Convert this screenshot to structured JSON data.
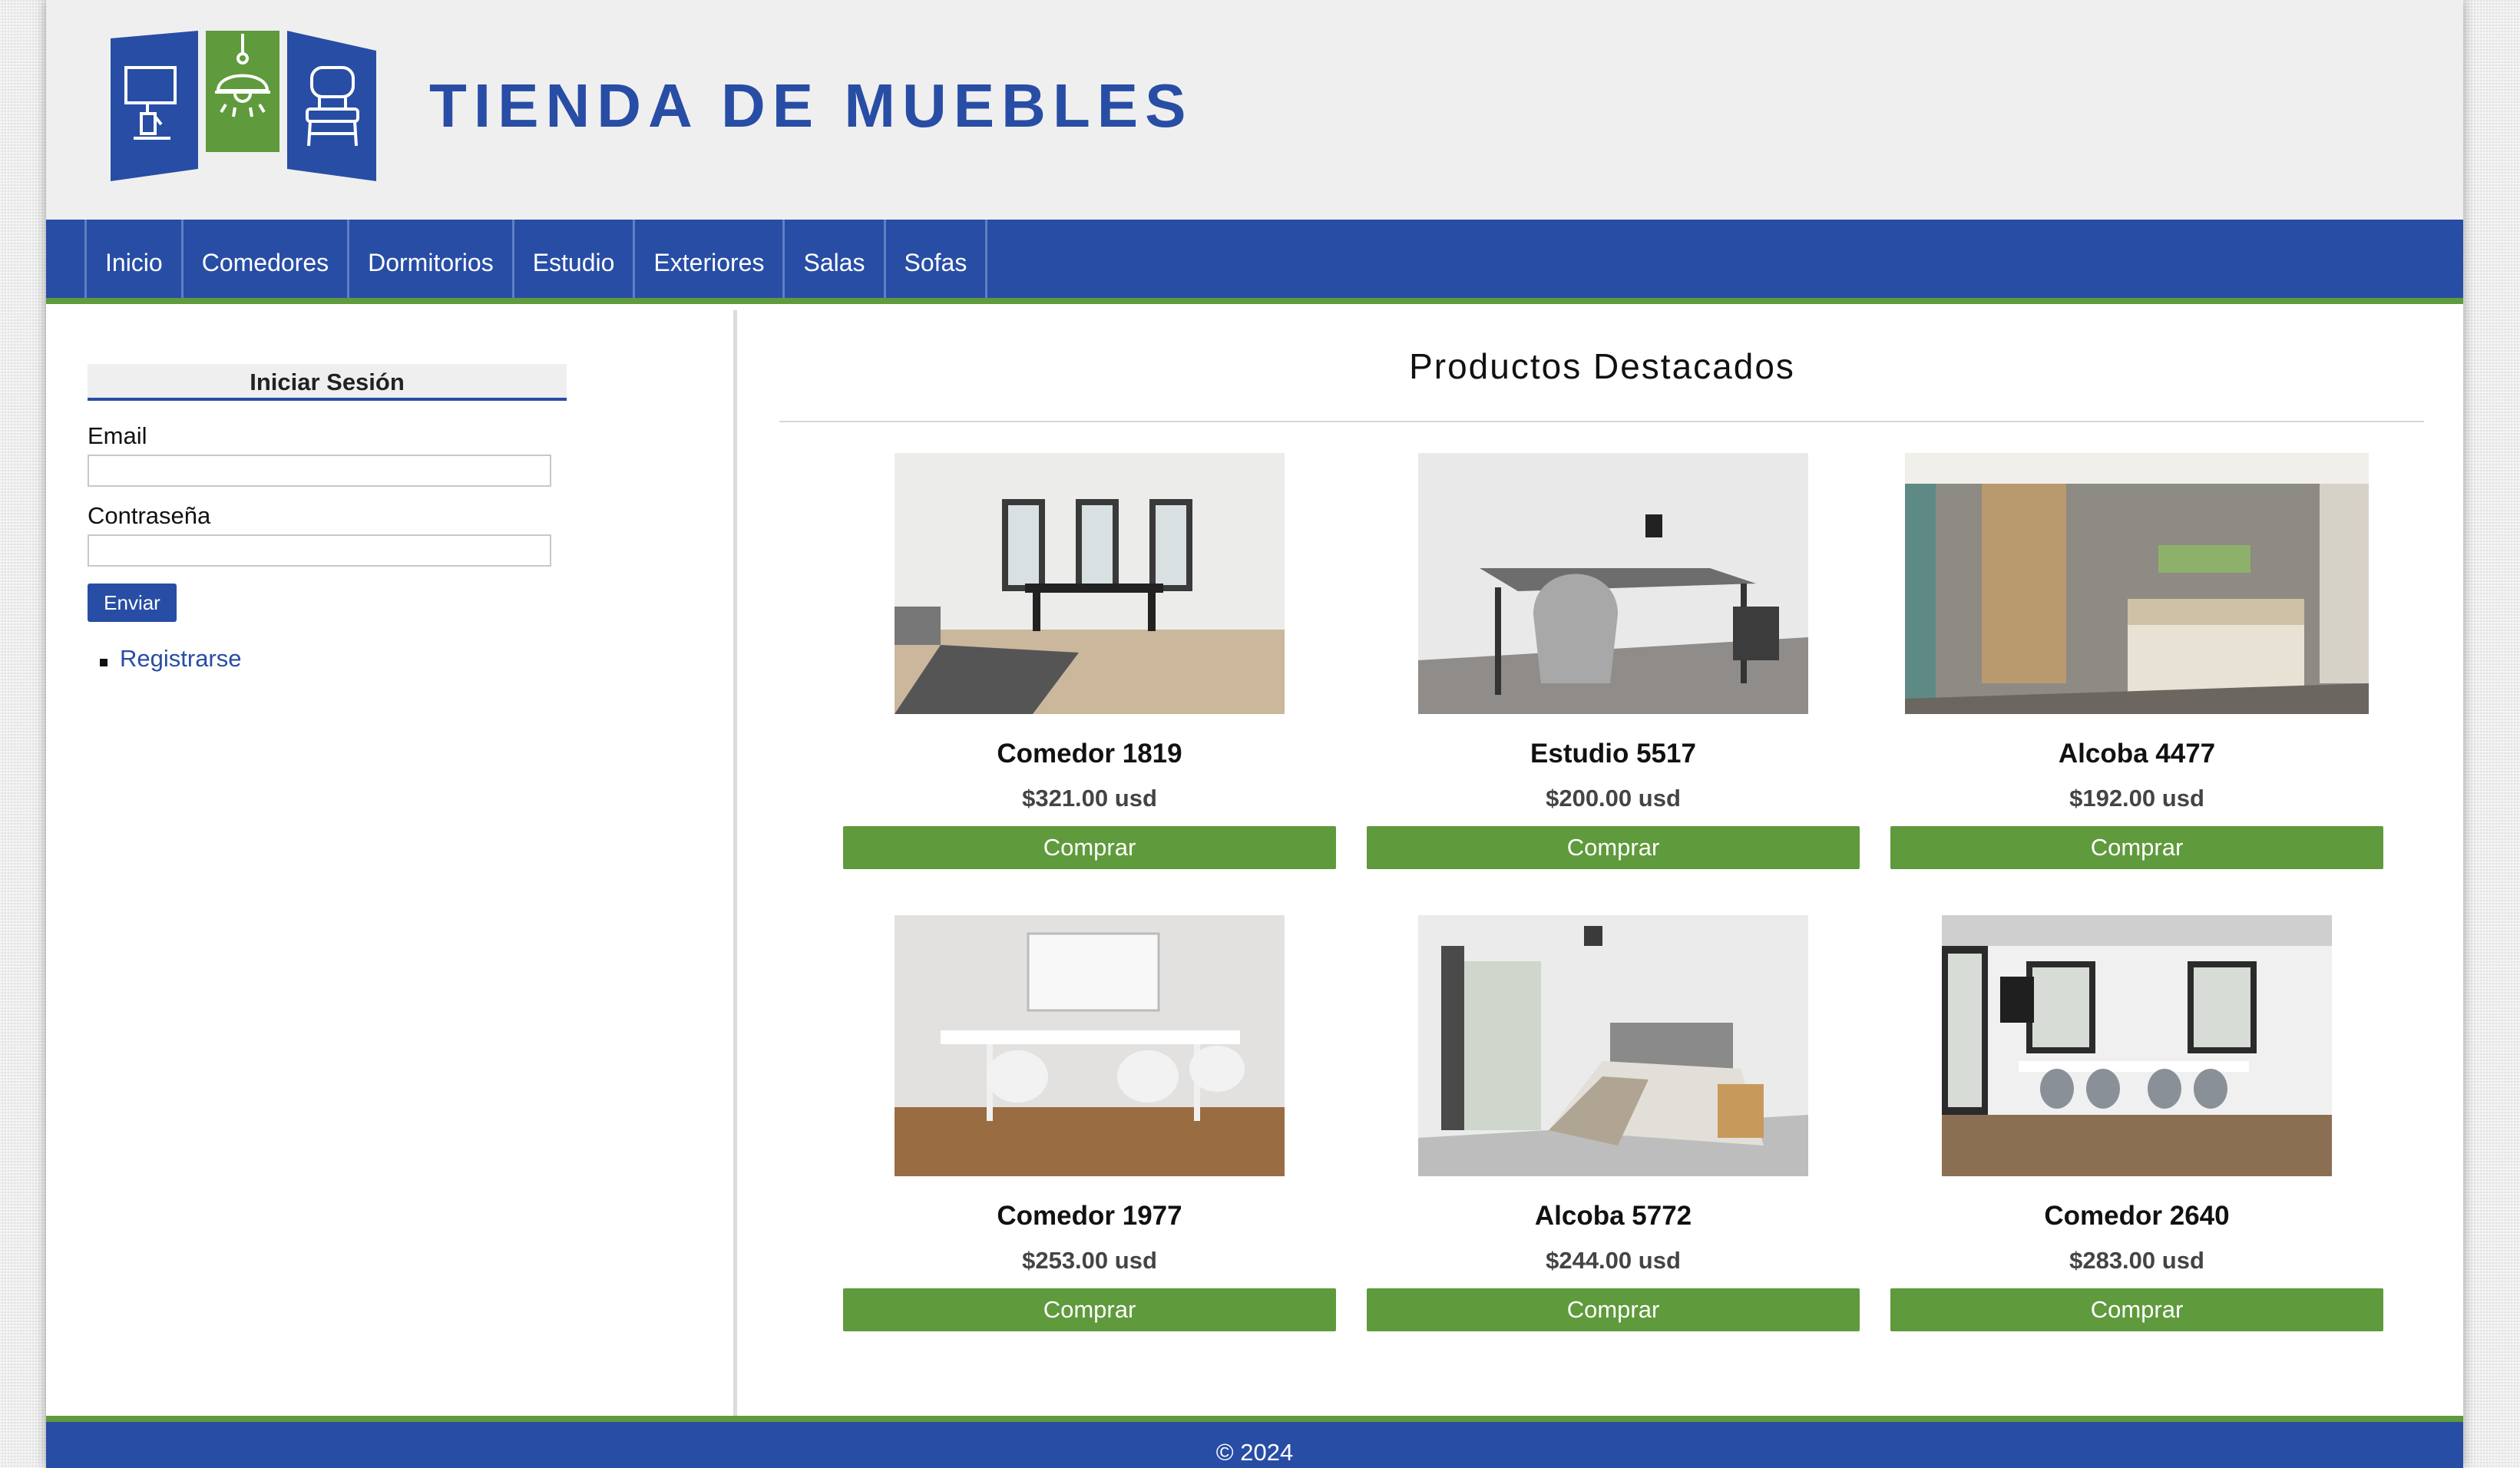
{
  "header": {
    "site_title": "TIENDA DE MUEBLES",
    "brand_colors": {
      "primary": "#284da5",
      "accent": "#5f9a3c"
    },
    "logo_icons": [
      "lamp-icon",
      "ceiling-light-icon",
      "chair-icon"
    ]
  },
  "nav": {
    "items": [
      {
        "label": "Inicio"
      },
      {
        "label": "Comedores"
      },
      {
        "label": "Dormitorios"
      },
      {
        "label": "Estudio"
      },
      {
        "label": "Exteriores"
      },
      {
        "label": "Salas"
      },
      {
        "label": "Sofas"
      }
    ]
  },
  "login": {
    "title": "Iniciar Sesión",
    "email_label": "Email",
    "email_value": "",
    "password_label": "Contraseña",
    "password_value": "",
    "submit_label": "Enviar",
    "register_label": "Registrarse"
  },
  "featured": {
    "title": "Productos Destacados",
    "buy_label": "Comprar",
    "products": [
      {
        "name": "Comedor 1819",
        "price": "$321.00 usd",
        "image": "dining-room-photo"
      },
      {
        "name": "Estudio 5517",
        "price": "$200.00 usd",
        "image": "study-desk-photo"
      },
      {
        "name": "Alcoba 4477",
        "price": "$192.00 usd",
        "image": "bedroom-photo"
      },
      {
        "name": "Comedor 1977",
        "price": "$253.00 usd",
        "image": "dining-room-photo"
      },
      {
        "name": "Alcoba 5772",
        "price": "$244.00 usd",
        "image": "bedroom-photo"
      },
      {
        "name": "Comedor 2640",
        "price": "$283.00 usd",
        "image": "dining-room-photo"
      }
    ]
  },
  "footer": {
    "copyright": "© 2024"
  }
}
